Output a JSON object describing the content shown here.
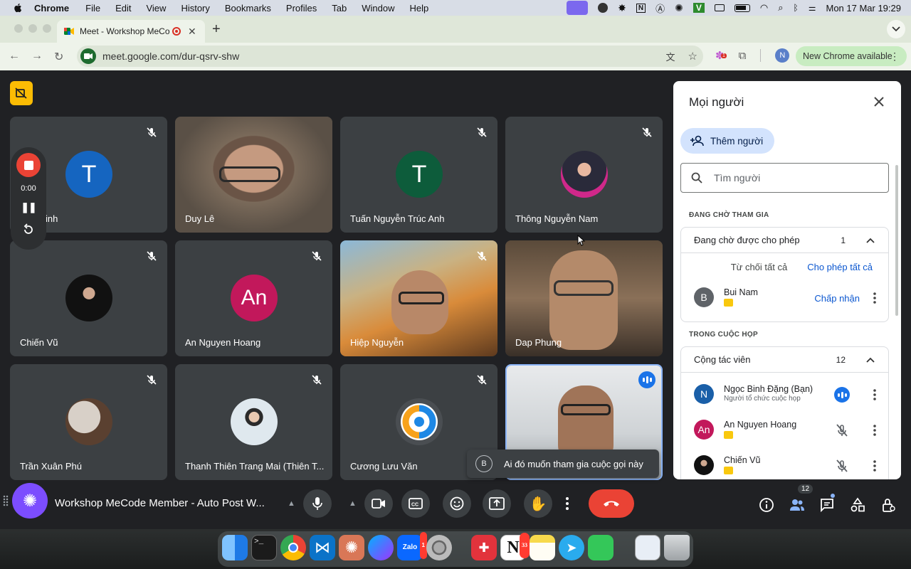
{
  "menubar": {
    "app": "Chrome",
    "items": [
      "File",
      "Edit",
      "View",
      "History",
      "Bookmarks",
      "Profiles",
      "Tab",
      "Window",
      "Help"
    ],
    "clock": "Mon 17 Mar  19:29"
  },
  "browser": {
    "tab_title": "Meet - Workshop MeCode",
    "url": "meet.google.com/dur-qsrv-shw",
    "new_chrome": "New Chrome available",
    "profile_initial": "N"
  },
  "recorder": {
    "time": "0:00"
  },
  "tiles": [
    {
      "name": "inh",
      "initial": "T",
      "color": "#1565c0"
    },
    {
      "name": "Duy Lê"
    },
    {
      "name": "Tuấn Nguyễn Trúc Anh",
      "initial": "T",
      "color": "#0d5c3b"
    },
    {
      "name": "Thông Nguyễn Nam"
    },
    {
      "name": "Chiến Vũ"
    },
    {
      "name": "An Nguyen Hoang",
      "initial": "An",
      "color": "#c2185b"
    },
    {
      "name": "Hiệp Nguyễn"
    },
    {
      "name": "Dap Phung"
    },
    {
      "name": "Trần Xuân Phú"
    },
    {
      "name": "Thanh Thiên Trang Mai (Thiên T..."
    },
    {
      "name": "Cương Lưu Văn"
    },
    {
      "name": ""
    }
  ],
  "panel": {
    "title": "Mọi người",
    "add_people": "Thêm người",
    "search_placeholder": "Tìm người",
    "waiting_section": "ĐANG CHỜ THAM GIA",
    "waiting_group": {
      "label": "Đang chờ được cho phép",
      "count": "1"
    },
    "deny_all": "Từ chối tất cả",
    "allow_all": "Cho phép tất cả",
    "waiting_person": {
      "initial": "B",
      "name": "Bui Nam",
      "accept": "Chấp nhận"
    },
    "in_meeting_section": "TRONG CUỘC HỌP",
    "collab_group": {
      "label": "Cộng tác viên",
      "count": "12"
    },
    "members": [
      {
        "initial": "N",
        "name": "Ngọc Binh Đặng (Bạn)",
        "subtitle": "Người tổ chức cuộc họp",
        "color": "#1a5fa8"
      },
      {
        "initial": "An",
        "name": "An Nguyen Hoang",
        "color": "#c2185b"
      },
      {
        "initial": "",
        "name": "Chiến Vũ",
        "color": "#222"
      }
    ]
  },
  "toast": {
    "initial": "B",
    "text": "Ai đó muốn tham gia cuộc gọi này"
  },
  "bottom": {
    "meeting_title": "Workshop MeCode Member - Auto Post W...",
    "people_badge": "12"
  },
  "dock": {
    "zalo_badge": "1",
    "notion_badge": "33"
  }
}
